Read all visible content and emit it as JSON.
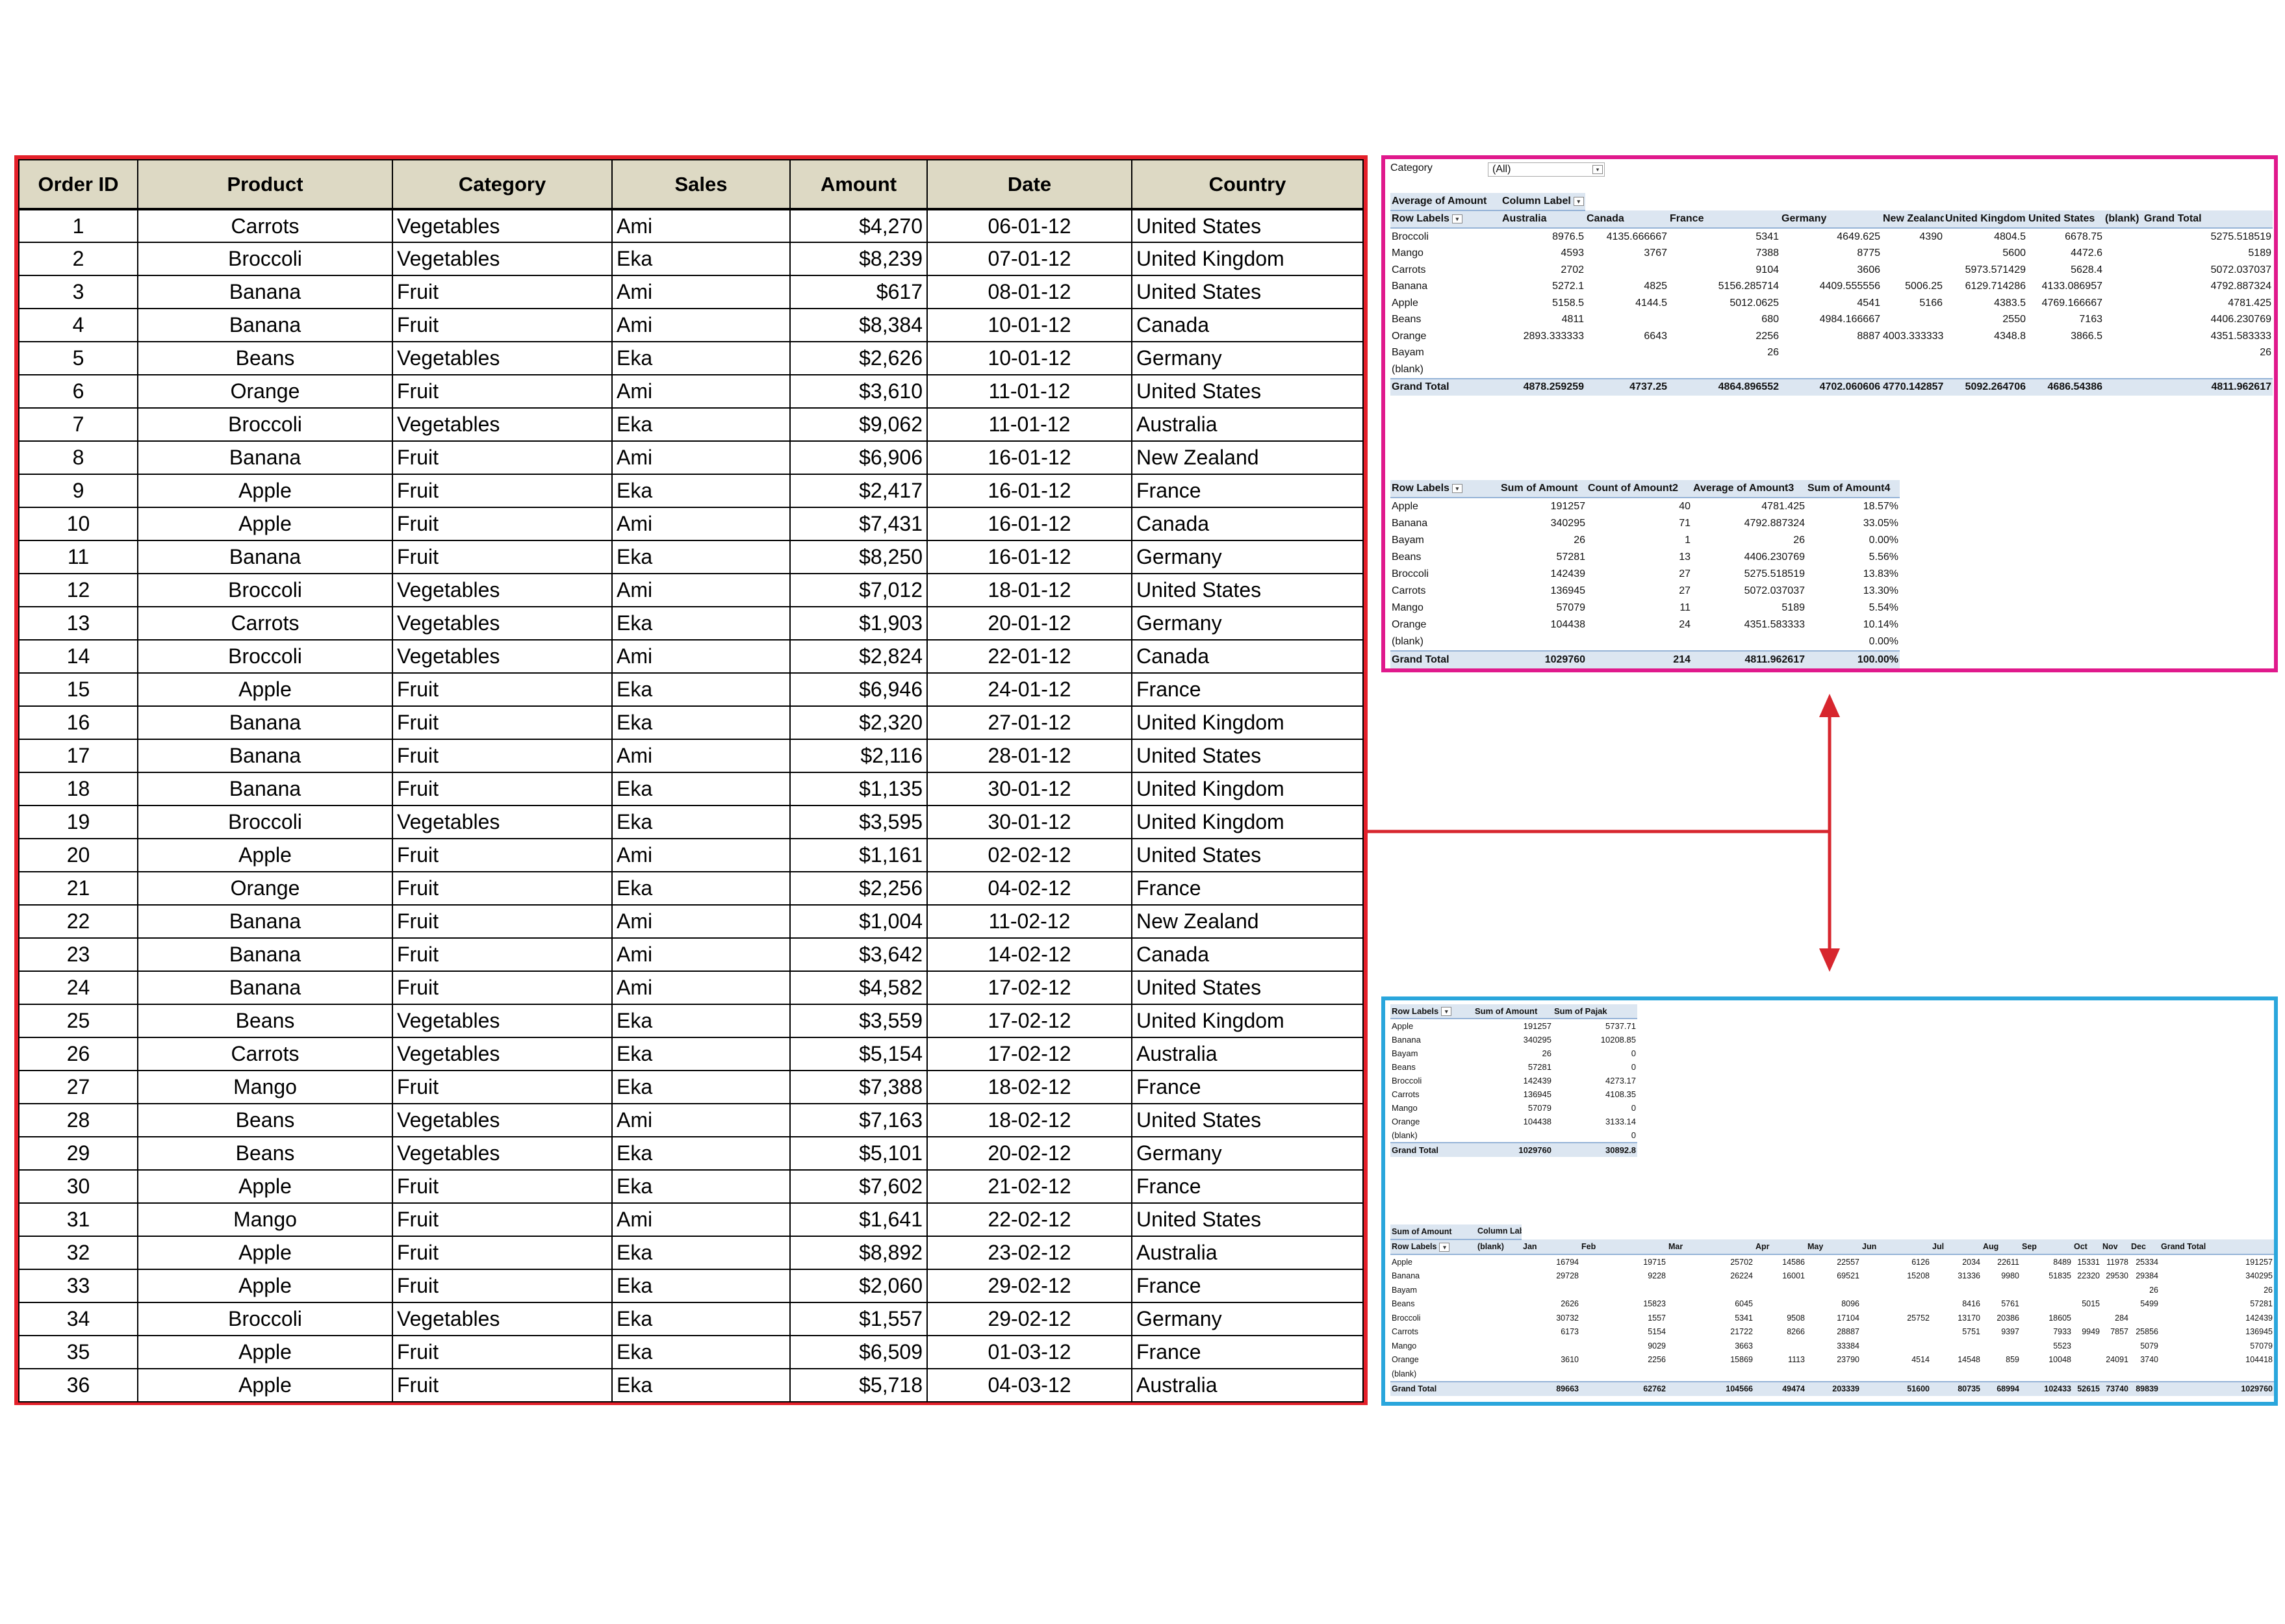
{
  "main_table": {
    "headers": [
      "Order ID",
      "Product",
      "Category",
      "Sales",
      "Amount",
      "Date",
      "Country"
    ],
    "rows": [
      [
        "1",
        "Carrots",
        "Vegetables",
        "Ami",
        "$4,270",
        "06-01-12",
        "United States"
      ],
      [
        "2",
        "Broccoli",
        "Vegetables",
        "Eka",
        "$8,239",
        "07-01-12",
        "United Kingdom"
      ],
      [
        "3",
        "Banana",
        "Fruit",
        "Ami",
        "$617",
        "08-01-12",
        "United States"
      ],
      [
        "4",
        "Banana",
        "Fruit",
        "Ami",
        "$8,384",
        "10-01-12",
        "Canada"
      ],
      [
        "5",
        "Beans",
        "Vegetables",
        "Eka",
        "$2,626",
        "10-01-12",
        "Germany"
      ],
      [
        "6",
        "Orange",
        "Fruit",
        "Ami",
        "$3,610",
        "11-01-12",
        "United States"
      ],
      [
        "7",
        "Broccoli",
        "Vegetables",
        "Eka",
        "$9,062",
        "11-01-12",
        "Australia"
      ],
      [
        "8",
        "Banana",
        "Fruit",
        "Ami",
        "$6,906",
        "16-01-12",
        "New Zealand"
      ],
      [
        "9",
        "Apple",
        "Fruit",
        "Eka",
        "$2,417",
        "16-01-12",
        "France"
      ],
      [
        "10",
        "Apple",
        "Fruit",
        "Ami",
        "$7,431",
        "16-01-12",
        "Canada"
      ],
      [
        "11",
        "Banana",
        "Fruit",
        "Eka",
        "$8,250",
        "16-01-12",
        "Germany"
      ],
      [
        "12",
        "Broccoli",
        "Vegetables",
        "Ami",
        "$7,012",
        "18-01-12",
        "United States"
      ],
      [
        "13",
        "Carrots",
        "Vegetables",
        "Eka",
        "$1,903",
        "20-01-12",
        "Germany"
      ],
      [
        "14",
        "Broccoli",
        "Vegetables",
        "Ami",
        "$2,824",
        "22-01-12",
        "Canada"
      ],
      [
        "15",
        "Apple",
        "Fruit",
        "Eka",
        "$6,946",
        "24-01-12",
        "France"
      ],
      [
        "16",
        "Banana",
        "Fruit",
        "Eka",
        "$2,320",
        "27-01-12",
        "United Kingdom"
      ],
      [
        "17",
        "Banana",
        "Fruit",
        "Ami",
        "$2,116",
        "28-01-12",
        "United States"
      ],
      [
        "18",
        "Banana",
        "Fruit",
        "Eka",
        "$1,135",
        "30-01-12",
        "United Kingdom"
      ],
      [
        "19",
        "Broccoli",
        "Vegetables",
        "Eka",
        "$3,595",
        "30-01-12",
        "United Kingdom"
      ],
      [
        "20",
        "Apple",
        "Fruit",
        "Ami",
        "$1,161",
        "02-02-12",
        "United States"
      ],
      [
        "21",
        "Orange",
        "Fruit",
        "Eka",
        "$2,256",
        "04-02-12",
        "France"
      ],
      [
        "22",
        "Banana",
        "Fruit",
        "Ami",
        "$1,004",
        "11-02-12",
        "New Zealand"
      ],
      [
        "23",
        "Banana",
        "Fruit",
        "Ami",
        "$3,642",
        "14-02-12",
        "Canada"
      ],
      [
        "24",
        "Banana",
        "Fruit",
        "Ami",
        "$4,582",
        "17-02-12",
        "United States"
      ],
      [
        "25",
        "Beans",
        "Vegetables",
        "Eka",
        "$3,559",
        "17-02-12",
        "United Kingdom"
      ],
      [
        "26",
        "Carrots",
        "Vegetables",
        "Eka",
        "$5,154",
        "17-02-12",
        "Australia"
      ],
      [
        "27",
        "Mango",
        "Fruit",
        "Eka",
        "$7,388",
        "18-02-12",
        "France"
      ],
      [
        "28",
        "Beans",
        "Vegetables",
        "Ami",
        "$7,163",
        "18-02-12",
        "United States"
      ],
      [
        "29",
        "Beans",
        "Vegetables",
        "Eka",
        "$5,101",
        "20-02-12",
        "Germany"
      ],
      [
        "30",
        "Apple",
        "Fruit",
        "Eka",
        "$7,602",
        "21-02-12",
        "France"
      ],
      [
        "31",
        "Mango",
        "Fruit",
        "Ami",
        "$1,641",
        "22-02-12",
        "United States"
      ],
      [
        "32",
        "Apple",
        "Fruit",
        "Eka",
        "$8,892",
        "23-02-12",
        "Australia"
      ],
      [
        "33",
        "Apple",
        "Fruit",
        "Eka",
        "$2,060",
        "29-02-12",
        "France"
      ],
      [
        "34",
        "Broccoli",
        "Vegetables",
        "Eka",
        "$1,557",
        "29-02-12",
        "Germany"
      ],
      [
        "35",
        "Apple",
        "Fruit",
        "Eka",
        "$6,509",
        "01-03-12",
        "France"
      ],
      [
        "36",
        "Apple",
        "Fruit",
        "Eka",
        "$5,718",
        "04-03-12",
        "Australia"
      ]
    ]
  },
  "pivot_country": {
    "filter_label": "Category",
    "filter_value": "(All)",
    "header1": [
      "Average of Amount",
      "Column Label"
    ],
    "header2": [
      "Row Labels",
      "Australia",
      "Canada",
      "France",
      "Germany",
      "New Zealand",
      "United Kingdom",
      "United States",
      "(blank)",
      "Grand Total"
    ],
    "rows": [
      [
        "Broccoli",
        "8976.5",
        "4135.666667",
        "5341",
        "4649.625",
        "4390",
        "4804.5",
        "6678.75",
        "",
        "5275.518519"
      ],
      [
        "Mango",
        "4593",
        "3767",
        "7388",
        "8775",
        "",
        "5600",
        "4472.6",
        "",
        "5189"
      ],
      [
        "Carrots",
        "2702",
        "",
        "9104",
        "3606",
        "",
        "5973.571429",
        "5628.4",
        "",
        "5072.037037"
      ],
      [
        "Banana",
        "5272.1",
        "4825",
        "5156.285714",
        "4409.555556",
        "5006.25",
        "6129.714286",
        "4133.086957",
        "",
        "4792.887324"
      ],
      [
        "Apple",
        "5158.5",
        "4144.5",
        "5012.0625",
        "4541",
        "5166",
        "4383.5",
        "4769.166667",
        "",
        "4781.425"
      ],
      [
        "Beans",
        "4811",
        "",
        "680",
        "4984.166667",
        "",
        "2550",
        "7163",
        "",
        "4406.230769"
      ],
      [
        "Orange",
        "2893.333333",
        "6643",
        "2256",
        "8887",
        "4003.333333",
        "4348.8",
        "3866.5",
        "",
        "4351.583333"
      ],
      [
        "Bayam",
        "",
        "",
        "26",
        "",
        "",
        "",
        "",
        "",
        "26"
      ],
      [
        "(blank)",
        "",
        "",
        "",
        "",
        "",
        "",
        "",
        "",
        ""
      ]
    ],
    "total": [
      "Grand Total",
      "4878.259259",
      "4737.25",
      "4864.896552",
      "4702.060606",
      "4770.142857",
      "5092.264706",
      "4686.54386",
      "",
      "4811.962617"
    ]
  },
  "pivot_summary": {
    "headers": [
      "Row Labels",
      "Sum of Amount",
      "Count of Amount2",
      "Average of Amount3",
      "Sum of Amount4"
    ],
    "rows": [
      [
        "Apple",
        "191257",
        "40",
        "4781.425",
        "18.57%"
      ],
      [
        "Banana",
        "340295",
        "71",
        "4792.887324",
        "33.05%"
      ],
      [
        "Bayam",
        "26",
        "1",
        "26",
        "0.00%"
      ],
      [
        "Beans",
        "57281",
        "13",
        "4406.230769",
        "5.56%"
      ],
      [
        "Broccoli",
        "142439",
        "27",
        "5275.518519",
        "13.83%"
      ],
      [
        "Carrots",
        "136945",
        "27",
        "5072.037037",
        "13.30%"
      ],
      [
        "Mango",
        "57079",
        "11",
        "5189",
        "5.54%"
      ],
      [
        "Orange",
        "104438",
        "24",
        "4351.583333",
        "10.14%"
      ],
      [
        "(blank)",
        "",
        "",
        "",
        "0.00%"
      ]
    ],
    "total": [
      "Grand Total",
      "1029760",
      "214",
      "4811.962617",
      "100.00%"
    ]
  },
  "pivot_pajak": {
    "headers": [
      "Row Labels",
      "Sum of Amount",
      "Sum of Pajak"
    ],
    "rows": [
      [
        "Apple",
        "191257",
        "5737.71"
      ],
      [
        "Banana",
        "340295",
        "10208.85"
      ],
      [
        "Bayam",
        "26",
        "0"
      ],
      [
        "Beans",
        "57281",
        "0"
      ],
      [
        "Broccoli",
        "142439",
        "4273.17"
      ],
      [
        "Carrots",
        "136945",
        "4108.35"
      ],
      [
        "Mango",
        "57079",
        "0"
      ],
      [
        "Orange",
        "104438",
        "3133.14"
      ],
      [
        "(blank)",
        "",
        "0"
      ]
    ],
    "total": [
      "Grand Total",
      "1029760",
      "30892.8"
    ]
  },
  "pivot_month": {
    "header1": [
      "Sum of Amount",
      "Column Label"
    ],
    "header2": [
      "Row Labels",
      "(blank)",
      "Jan",
      "Feb",
      "Mar",
      "Apr",
      "May",
      "Jun",
      "Jul",
      "Aug",
      "Sep",
      "Oct",
      "Nov",
      "Dec",
      "Grand Total"
    ],
    "rows": [
      [
        "Apple",
        "",
        "16794",
        "19715",
        "25702",
        "14586",
        "22557",
        "6126",
        "2034",
        "22611",
        "8489",
        "15331",
        "11978",
        "25334",
        "191257"
      ],
      [
        "Banana",
        "",
        "29728",
        "9228",
        "26224",
        "16001",
        "69521",
        "15208",
        "31336",
        "9980",
        "51835",
        "22320",
        "29530",
        "29384",
        "340295"
      ],
      [
        "Bayam",
        "",
        "",
        "",
        "",
        "",
        "",
        "",
        "",
        "",
        "",
        "",
        "",
        "26",
        "26"
      ],
      [
        "Beans",
        "",
        "2626",
        "15823",
        "6045",
        "",
        "8096",
        "",
        "8416",
        "5761",
        "",
        "5015",
        "",
        "5499",
        "57281"
      ],
      [
        "Broccoli",
        "",
        "30732",
        "1557",
        "5341",
        "9508",
        "17104",
        "25752",
        "13170",
        "20386",
        "18605",
        "",
        "284",
        "",
        "142439"
      ],
      [
        "Carrots",
        "",
        "6173",
        "5154",
        "21722",
        "8266",
        "28887",
        "",
        "5751",
        "9397",
        "7933",
        "9949",
        "7857",
        "25856",
        "136945"
      ],
      [
        "Mango",
        "",
        "",
        "9029",
        "3663",
        "",
        "33384",
        "",
        "",
        "",
        "5523",
        "",
        "",
        "5079",
        "57079"
      ],
      [
        "Orange",
        "",
        "3610",
        "2256",
        "15869",
        "1113",
        "23790",
        "4514",
        "14548",
        "859",
        "10048",
        "",
        "24091",
        "3740",
        "104418"
      ],
      [
        "(blank)",
        "",
        "",
        "",
        "",
        "",
        "",
        "",
        "",
        "",
        "",
        "",
        "",
        "",
        ""
      ]
    ],
    "total": [
      "Grand Total",
      "",
      "89663",
      "62762",
      "104566",
      "49474",
      "203339",
      "51600",
      "80735",
      "68994",
      "102433",
      "52615",
      "73740",
      "89839",
      "1029760"
    ]
  },
  "colors": {
    "main_border": "#e4202a",
    "pivot1_border": "#e0198c",
    "pivot2_border": "#2aa6dc",
    "header_fill": "#ddd9c4",
    "pivot_header_fill": "#dce6f1",
    "arrow": "#d7262e"
  }
}
